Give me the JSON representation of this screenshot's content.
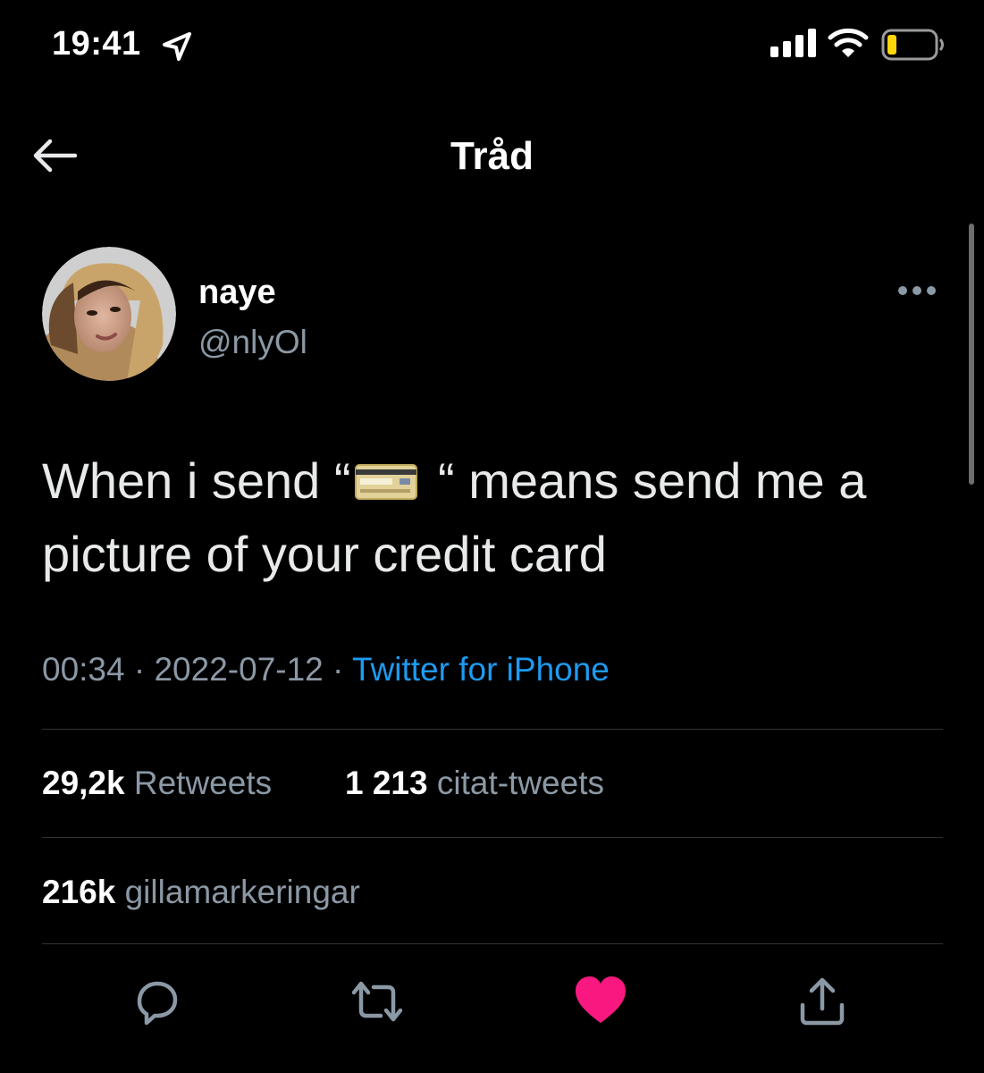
{
  "status_bar": {
    "time": "19:41",
    "icons": [
      "location-arrow-icon",
      "signal-bars-icon",
      "wifi-icon",
      "battery-icon"
    ]
  },
  "header": {
    "title": "Tråd",
    "back_icon": "arrow-left-icon"
  },
  "tweet": {
    "author_name": "naye",
    "author_handle": "@nlyOl",
    "text_part1": "When i send “",
    "text_emoji": "credit-card-emoji",
    "text_part2": " “ means send me a picture of your credit card",
    "time": "00:34",
    "separator": " · ",
    "date": "2022-07-12",
    "source": "Twitter for iPhone",
    "retweets_count": "29,2k",
    "retweets_label": "Retweets",
    "quotes_count": "1 213",
    "quotes_label": "citat-tweets",
    "likes_count": "216k",
    "likes_label": "gillamarkeringar",
    "liked": true
  },
  "colors": {
    "background": "#000000",
    "link": "#1d9bf0",
    "like_active": "#f91880",
    "muted": "#8b98a5",
    "battery_level": "#ffd60a"
  },
  "actions": [
    "reply-icon",
    "retweet-icon",
    "like-icon",
    "share-icon"
  ]
}
